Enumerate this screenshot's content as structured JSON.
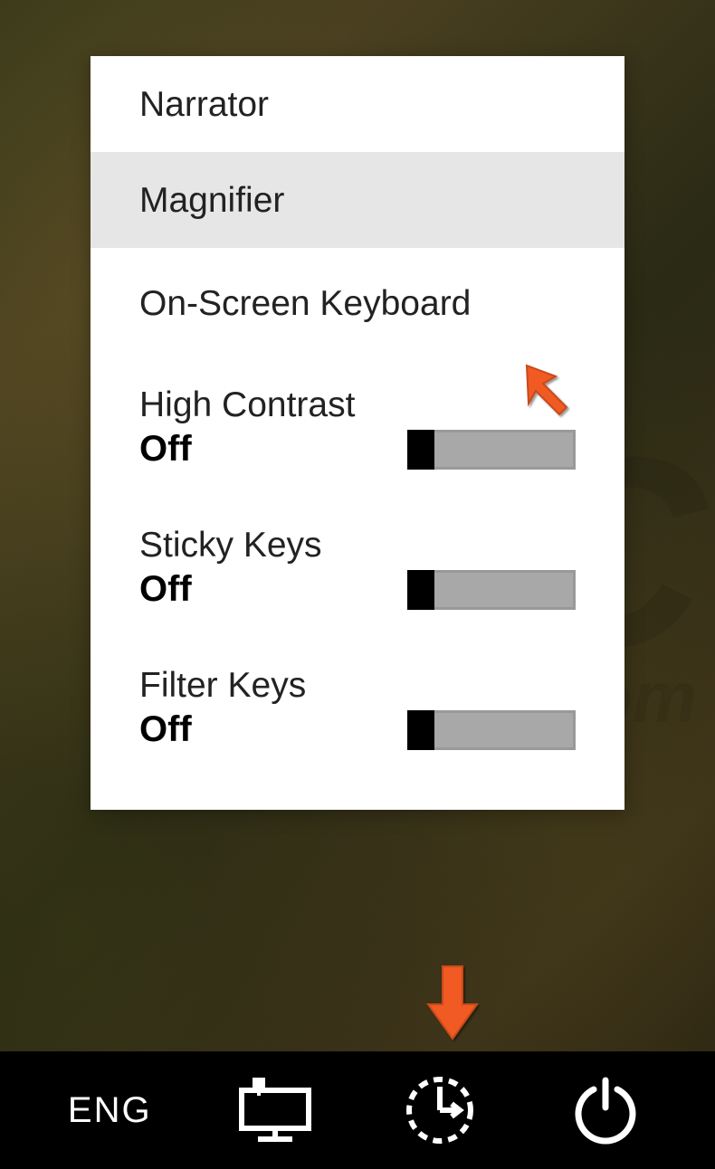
{
  "menu": {
    "items": [
      {
        "label": "Narrator",
        "hovered": false
      },
      {
        "label": "Magnifier",
        "hovered": true
      },
      {
        "label": "On-Screen Keyboard",
        "hovered": false
      }
    ],
    "toggles": [
      {
        "label": "High Contrast",
        "state": "Off"
      },
      {
        "label": "Sticky Keys",
        "state": "Off"
      },
      {
        "label": "Filter Keys",
        "state": "Off"
      }
    ]
  },
  "taskbar": {
    "language": "ENG"
  },
  "watermark": {
    "line1": "PC",
    "line2": "risk.com"
  }
}
